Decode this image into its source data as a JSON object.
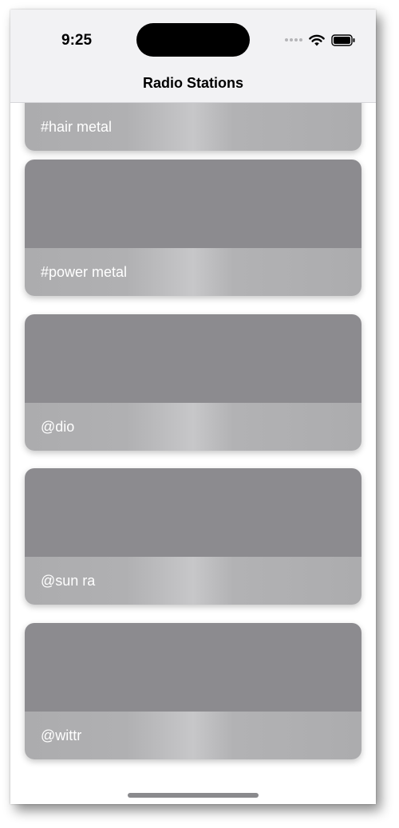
{
  "status": {
    "time": "9:25"
  },
  "nav": {
    "title": "Radio Stations"
  },
  "stations": [
    {
      "label": "#hair metal"
    },
    {
      "label": "#power metal"
    },
    {
      "label": "@dio"
    },
    {
      "label": "@sun ra"
    },
    {
      "label": "@wittr"
    }
  ],
  "colors": {
    "card_art": "#8c8b8f",
    "card_footer": "#b1b1b3",
    "nav_background": "#f2f2f4"
  },
  "icons": [
    "wifi-icon",
    "battery-icon",
    "signal-icon"
  ]
}
